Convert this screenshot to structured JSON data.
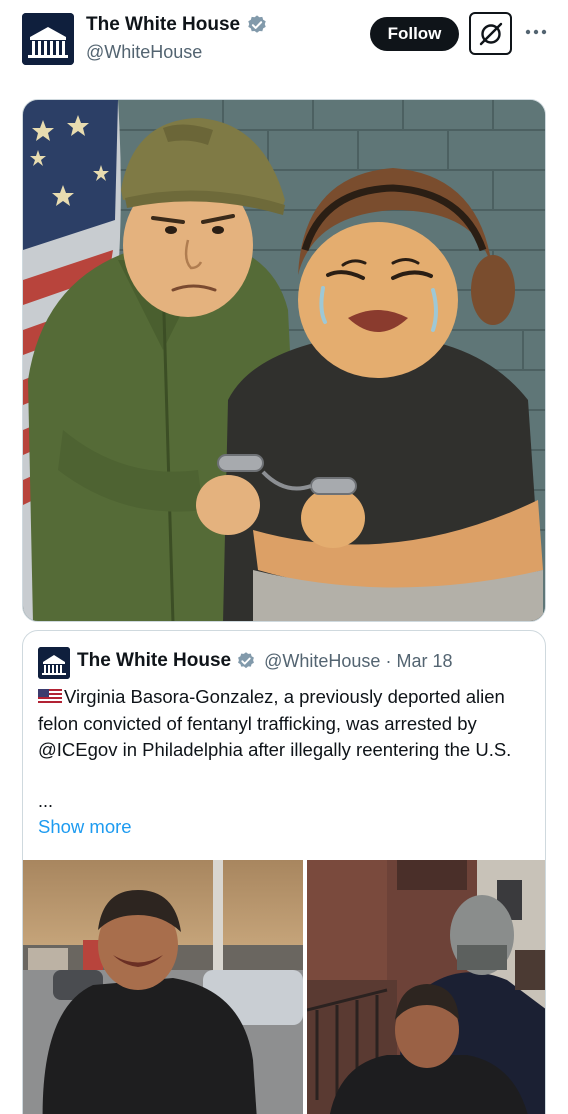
{
  "post": {
    "author_name": "The White House",
    "author_handle": "@WhiteHouse",
    "follow_label": "Follow",
    "more_label": "···"
  },
  "images": {
    "main_image": "illustration-of-arrest"
  },
  "quote": {
    "author_name": "The White House",
    "author_handle": "@WhiteHouse",
    "separator": "·",
    "date": "Mar 18",
    "text": "Virginia Basora-Gonzalez, a previously deported alien felon convicted of fentanyl trafficking, was arrested by @ICEgov in Philadelphia after illegally reentering the U.S.",
    "ellipsis": "...",
    "show_more_label": "Show more"
  },
  "colors": {
    "link": "#1d9bf0",
    "verified": "#829aab",
    "text_primary": "#0f1419",
    "text_secondary": "#536471",
    "border": "#cfd9de"
  }
}
